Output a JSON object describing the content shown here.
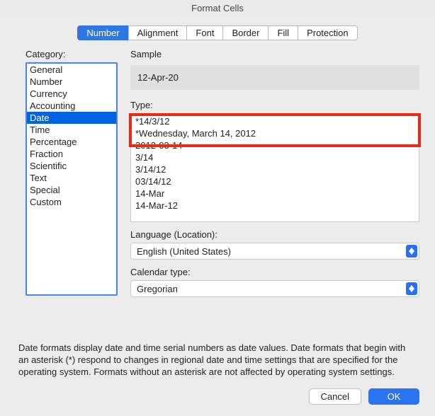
{
  "window": {
    "title": "Format Cells"
  },
  "tabs": [
    {
      "label": "Number",
      "active": true
    },
    {
      "label": "Alignment",
      "active": false
    },
    {
      "label": "Font",
      "active": false
    },
    {
      "label": "Border",
      "active": false
    },
    {
      "label": "Fill",
      "active": false
    },
    {
      "label": "Protection",
      "active": false
    }
  ],
  "category": {
    "label": "Category:",
    "items": [
      "General",
      "Number",
      "Currency",
      "Accounting",
      "Date",
      "Time",
      "Percentage",
      "Fraction",
      "Scientific",
      "Text",
      "Special",
      "Custom"
    ],
    "selected": "Date"
  },
  "sample": {
    "label": "Sample",
    "value": "12-Apr-20"
  },
  "type": {
    "label": "Type:",
    "items": [
      "*14/3/12",
      "*Wednesday, March 14, 2012",
      "2012-03-14",
      "3/14",
      "3/14/12",
      "03/14/12",
      "14-Mar",
      "14-Mar-12"
    ]
  },
  "language": {
    "label": "Language (Location):",
    "value": "English (United States)"
  },
  "calendar": {
    "label": "Calendar type:",
    "value": "Gregorian"
  },
  "footer": "Date formats display date and time serial numbers as date values.  Date formats that begin with an asterisk (*) respond to changes in regional date and time settings that are specified for the operating system. Formats without an asterisk are not affected by operating system settings.",
  "buttons": {
    "cancel": "Cancel",
    "ok": "OK"
  }
}
